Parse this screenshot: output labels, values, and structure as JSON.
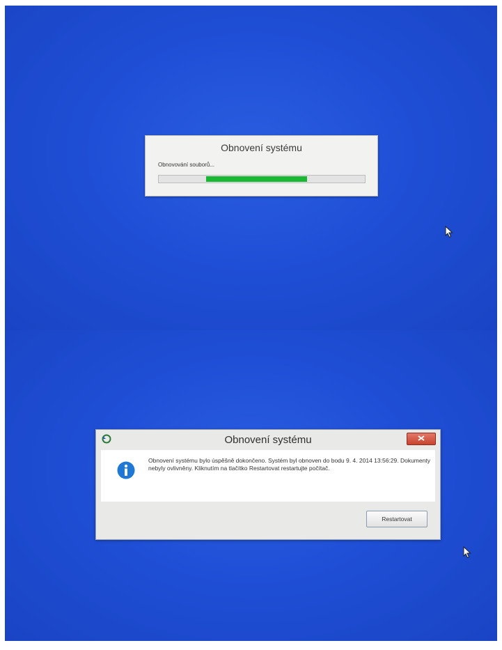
{
  "progress_dialog": {
    "title": "Obnovení systému",
    "status": "Obnovování souborů...",
    "progress_fill_segment": [
      0.23,
      0.72
    ],
    "progress_color": "#18b834"
  },
  "result_dialog": {
    "title": "Obnovení systému",
    "close_icon": "close-icon",
    "message": "Obnovení systému bylo úspěšně dokončeno. Systém byl obnoven do bodu 9. 4. 2014 13:56:29. Dokumenty nebyly ovlivněny. Kliknutím na tlačítko Restartovat restartujte počítač.",
    "info_icon": "info-icon",
    "restart_button": "Restartovat"
  },
  "colors": {
    "desktop": "#1f4fd6",
    "info_icon": "#1f78d6",
    "close_button": "#d4503c"
  }
}
